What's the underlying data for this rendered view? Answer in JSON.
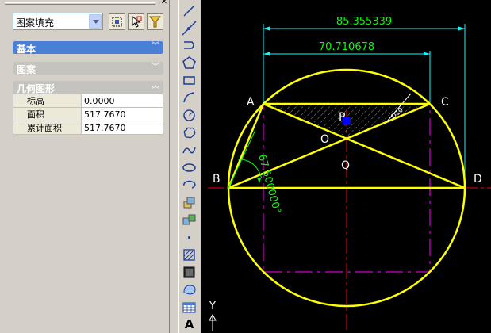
{
  "palette": {
    "object_type": "图案填充",
    "sections": [
      {
        "label": "基本",
        "state": "collapsed"
      },
      {
        "label": "图案",
        "state": "collapsed"
      },
      {
        "label": "几何图形",
        "state": "expanded"
      }
    ],
    "geometry": [
      {
        "key": "标高",
        "value": "0.0000"
      },
      {
        "key": "面积",
        "value": "517.7670"
      },
      {
        "key": "累计面积",
        "value": "517.7670"
      }
    ]
  },
  "toolbar": {
    "tools": [
      "line-icon",
      "construction-line-icon",
      "polyline-icon",
      "polygon-icon",
      "rectangle-icon",
      "arc-icon",
      "circle-icon",
      "revision-cloud-icon",
      "spline-icon",
      "ellipse-icon",
      "ellipse-arc-icon",
      "insert-block-icon",
      "make-block-icon",
      "point-icon",
      "hatch-icon",
      "gradient-icon",
      "region-icon",
      "table-icon",
      "multiline-text-icon"
    ],
    "text_tool_label": "A"
  },
  "drawing": {
    "dim_outer": "85.355339",
    "dim_inner": "70.710678",
    "dim_angle": "67.500000°",
    "dim_small": "D10",
    "points": {
      "A": "A",
      "B": "B",
      "C": "C",
      "D": "D",
      "O": "O",
      "P": "P",
      "Q": "Q"
    },
    "ucs_y": "Y",
    "colors": {
      "circle": "#ffff00",
      "dimension": "#00ff00",
      "extension": "#00ffff",
      "construction": "#ff00ff",
      "center": "#ff0000",
      "grip": "#0000ff",
      "labels": "#ffffff"
    }
  }
}
